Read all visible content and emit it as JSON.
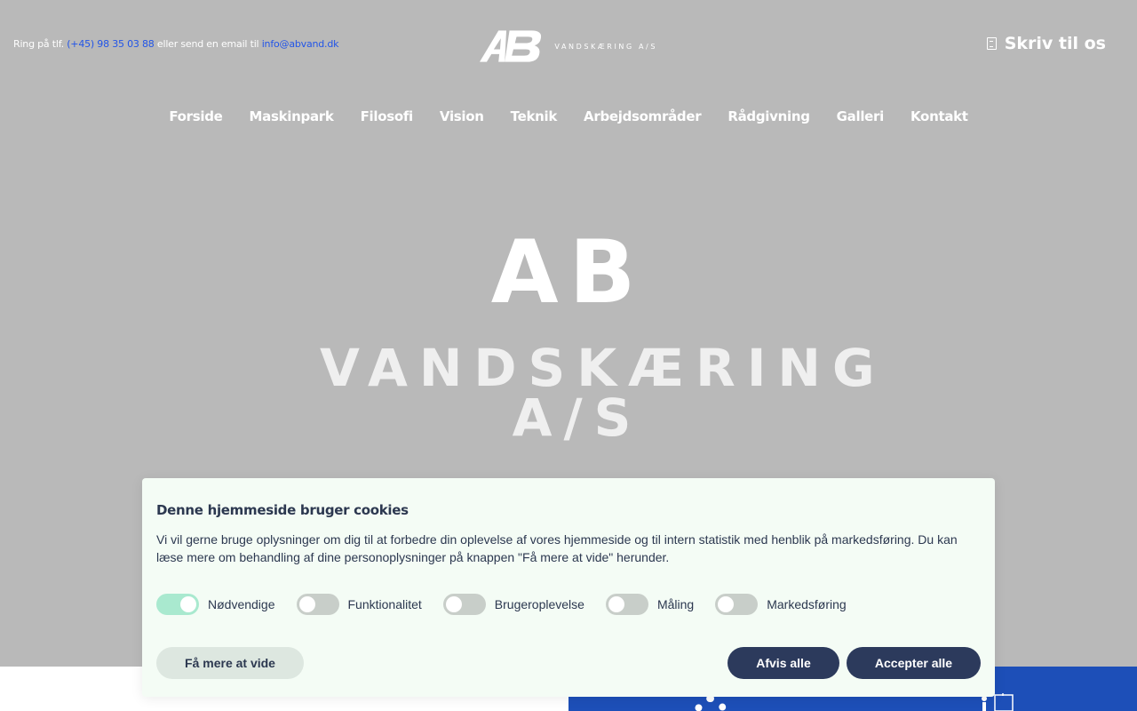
{
  "topbar": {
    "call_prefix": "Ring på tlf.",
    "phone": "(+45) 98 35 03 88",
    "middle_text": "eller send en email til",
    "email": "info@abvand.dk"
  },
  "logo": {
    "mark": "AB",
    "subtitle": "VANDSKÆRING A/S"
  },
  "header_action": {
    "label": "Skriv til os",
    "icon": "document-icon"
  },
  "nav": {
    "items": [
      "Forside",
      "Maskinpark",
      "Filosofi",
      "Vision",
      "Teknik",
      "Arbejdsområder",
      "Rådgivning",
      "Galleri",
      "Kontakt"
    ]
  },
  "hero": {
    "title": "AB",
    "subtitle": "VANDSKÆRING A/S"
  },
  "cookie_banner": {
    "title": "Denne hjemmeside bruger cookies",
    "text": "Vi vil gerne bruge oplysninger om dig til at forbedre din oplevelse af vores hjemmeside og til intern statistik med henblik på markedsføring. Du kan læse mere om behandling af dine personoplysninger på knappen \"Få mere at vide\" herunder.",
    "toggles": [
      {
        "label": "Nødvendige",
        "on": true
      },
      {
        "label": "Funktionalitet",
        "on": false
      },
      {
        "label": "Brugeroplevelse",
        "on": false
      },
      {
        "label": "Måling",
        "on": false
      },
      {
        "label": "Markedsføring",
        "on": false
      }
    ],
    "more_label": "Få mere at vide",
    "reject_label": "Afvis alle",
    "accept_label": "Accepter alle"
  },
  "colors": {
    "background": "#b9b9b9",
    "link": "#2255e8",
    "banner_bg": "#f4fcf5",
    "dark_button": "#2c3a5c",
    "toggle_on": "#a9e9cf",
    "section_blue": "#1d4fb8"
  }
}
